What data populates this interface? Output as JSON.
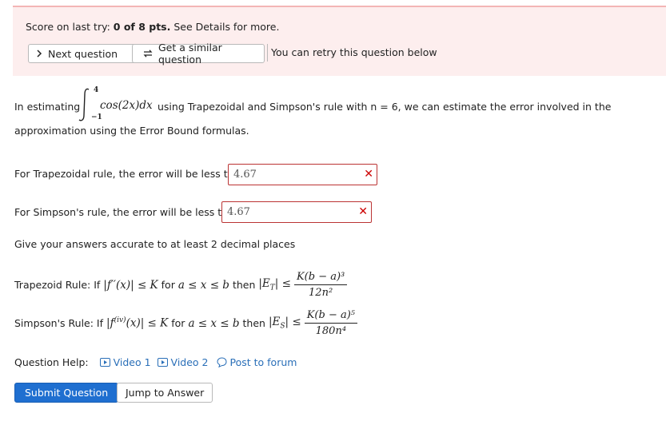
{
  "banner": {
    "score_prefix": "Score on last try: ",
    "score_value": "0 of 8 pts.",
    "score_suffix": " See Details for more.",
    "next_label": "Next question",
    "similar_label": "Get a similar question",
    "retry_text": "You can retry this question below"
  },
  "question": {
    "intro": "In estimating",
    "integral_upper": "4",
    "integral_lower": "−1",
    "integrand": "cos(2x)dx",
    "intro_rest": "using Trapezoidal and Simpson's rule with n = 6, we can estimate the error involved in the",
    "line2": "approximation using the Error Bound formulas.",
    "trap_label": "For Trapezoidal rule, the error will be less than",
    "trap_value": "4.67",
    "simp_label": "For Simpson's rule, the error will be less than",
    "simp_value": "4.67",
    "accuracy": "Give your answers accurate to at least 2 decimal places"
  },
  "rules": {
    "trap_prefix": "Trapezoid Rule: If",
    "trap_cond": "|f′′(x)| ≤ K",
    "trap_for": "for",
    "trap_range": "a ≤ x ≤ b",
    "trap_then": "then",
    "trap_bound": "|E",
    "trap_sub": "T",
    "trap_bound2": "| ≤",
    "trap_num": "K(b − a)³",
    "trap_den": "12n²",
    "simp_prefix": "Simpson's Rule: If",
    "simp_cond_a": "|f",
    "simp_sup": "(iv)",
    "simp_cond_b": "(x)| ≤ K",
    "simp_for": "for",
    "simp_range": "a ≤ x ≤ b",
    "simp_then": "then",
    "simp_bound": "|E",
    "simp_sub": "S",
    "simp_bound2": "| ≤",
    "simp_num": "K(b − a)⁵",
    "simp_den": "180n⁴"
  },
  "help": {
    "label": "Question Help:",
    "video1": "Video 1",
    "video2": "Video 2",
    "forum": "Post to forum"
  },
  "actions": {
    "submit": "Submit Question",
    "jump": "Jump to Answer"
  },
  "colors": {
    "banner_bg": "#fdeeee",
    "error_border": "#b33",
    "link": "#2a6fb8",
    "primary": "#1f6fd0"
  }
}
